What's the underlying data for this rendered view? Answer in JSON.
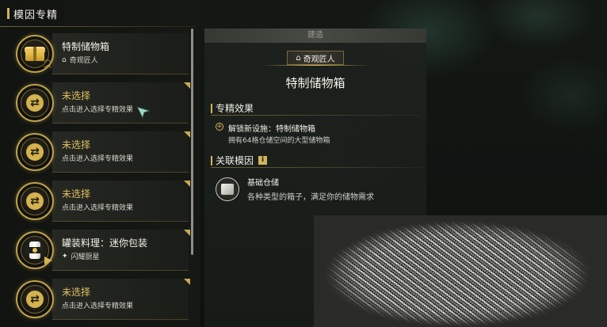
{
  "left_panel": {
    "title": "模因专精",
    "items": [
      {
        "title": "特制储物箱",
        "subtitle": "奇观匠人",
        "subtitle_icon": "home-icon",
        "icon": "chest-icon",
        "title_style": "white"
      },
      {
        "title": "未选择",
        "subtitle": "点击进入选择专精效果",
        "icon": "swap-icon",
        "title_style": "gold"
      },
      {
        "title": "未选择",
        "subtitle": "点击进入选择专精效果",
        "icon": "swap-icon",
        "title_style": "gold"
      },
      {
        "title": "未选择",
        "subtitle": "点击进入选择专精效果",
        "icon": "swap-icon",
        "title_style": "gold"
      },
      {
        "title": "罐装料理：迷你包装",
        "subtitle": "闪耀厨星",
        "subtitle_icon": "star-wing-icon",
        "icon": "can-icon",
        "title_style": "white"
      },
      {
        "title": "未选择",
        "subtitle": "点击进入选择专精效果",
        "icon": "swap-icon",
        "title_style": "gold"
      }
    ]
  },
  "detail": {
    "header": "建造",
    "owner_tag": "奇观匠人",
    "title": "特制储物箱",
    "effect_section": "专精效果",
    "effect_main": "解锁新设施：特制储物箱",
    "effect_desc": "拥有64格仓储空间的大型储物箱",
    "related_section": "关联模因",
    "related_name": "基础仓储",
    "related_desc": "各种类型的箱子，满足你的储物需求"
  },
  "colors": {
    "accent_gold": "#d2b45a",
    "text_light": "#f0eee6"
  }
}
